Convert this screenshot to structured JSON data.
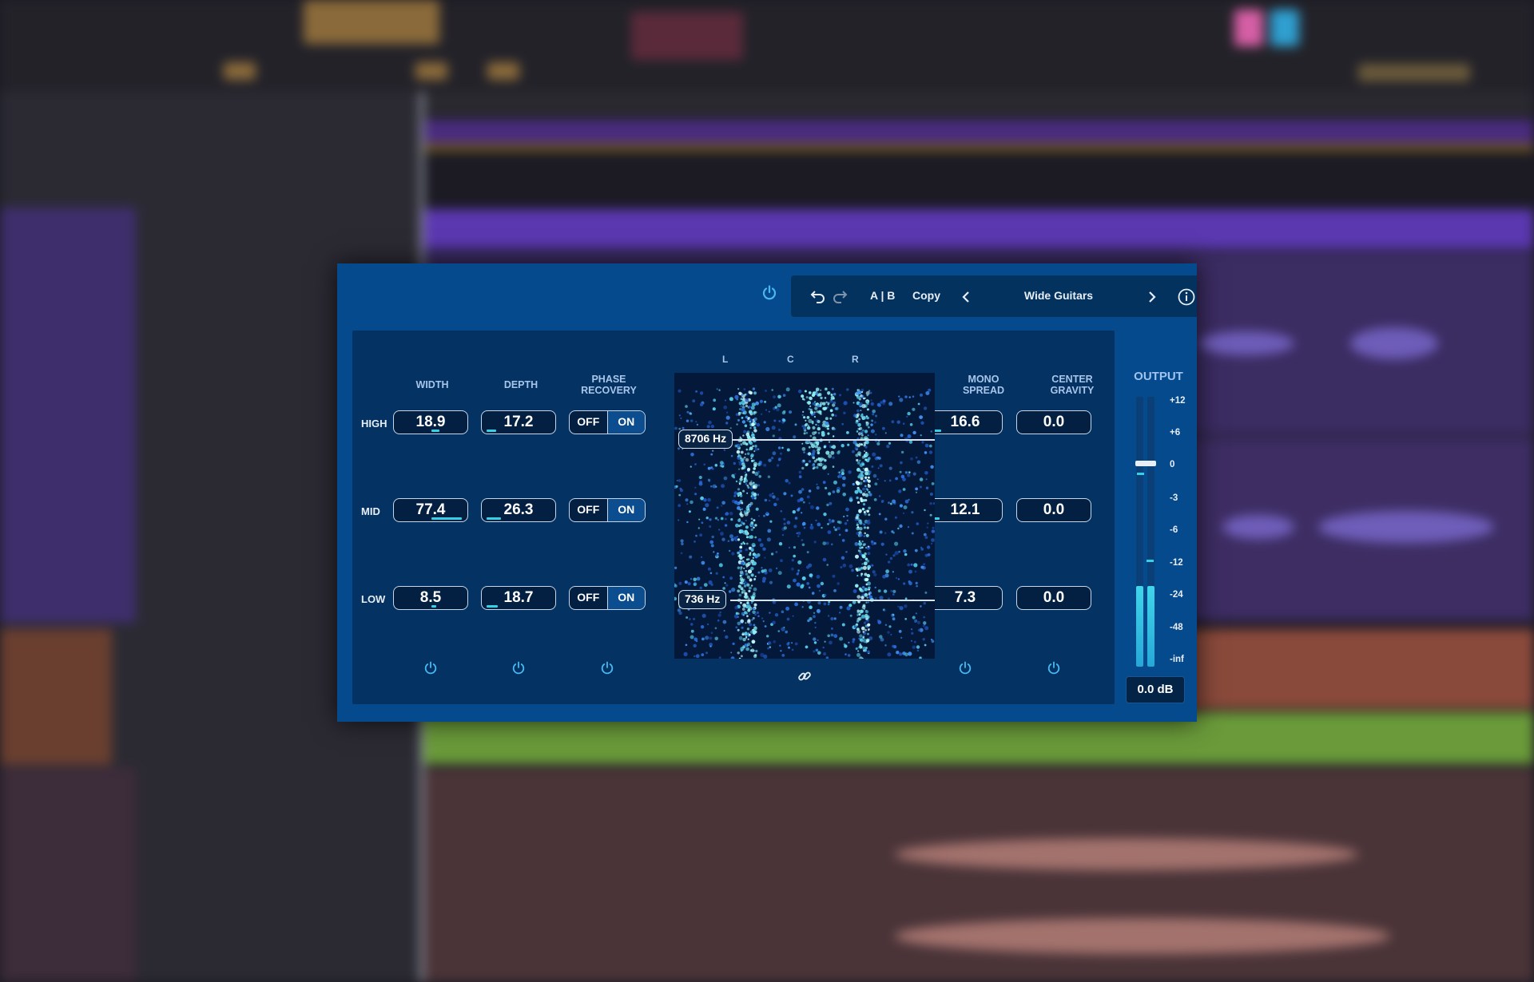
{
  "header": {
    "undo_icon": "undo-icon",
    "redo_icon": "redo-icon",
    "ab_label": "A | B",
    "copy_label": "Copy",
    "preset_name": "Wide Guitars",
    "prev_icon": "chevron-left-icon",
    "next_icon": "chevron-right-icon",
    "info_icon": "info-icon"
  },
  "columns": {
    "width": "WIDTH",
    "depth": "DEPTH",
    "phase_recovery_line1": "PHASE",
    "phase_recovery_line2": "RECOVERY",
    "mono_spread_line1": "MONO",
    "mono_spread_line2": "SPREAD",
    "center_gravity_line1": "CENTER",
    "center_gravity_line2": "GRAVITY"
  },
  "bands": [
    {
      "label": "HIGH",
      "width": "18.9",
      "depth": "17.2",
      "phase_off": "OFF",
      "phase_on": "ON",
      "mono_spread": "16.6",
      "center_gravity": "0.0"
    },
    {
      "label": "MID",
      "width": "77.4",
      "depth": "26.3",
      "phase_off": "OFF",
      "phase_on": "ON",
      "mono_spread": "12.1",
      "center_gravity": "0.0"
    },
    {
      "label": "LOW",
      "width": "8.5",
      "depth": "18.7",
      "phase_off": "OFF",
      "phase_on": "ON",
      "mono_spread": "7.3",
      "center_gravity": "0.0"
    }
  ],
  "visualizer": {
    "left": "L",
    "center": "C",
    "right": "R",
    "high_crossover": "8706 Hz",
    "low_crossover": "736 Hz",
    "link_icon": "link-icon"
  },
  "output": {
    "label": "OUTPUT",
    "scale": [
      "+12",
      "+6",
      "0",
      "-3",
      "-6",
      "-12",
      "-24",
      "-48",
      "-inf"
    ],
    "value": "0.0 dB",
    "level_left": 0.3,
    "level_right": 0.3
  },
  "colors": {
    "plugin_bg": "#064a8e",
    "panel_bg": "#033263",
    "accent": "#35d0e6"
  }
}
